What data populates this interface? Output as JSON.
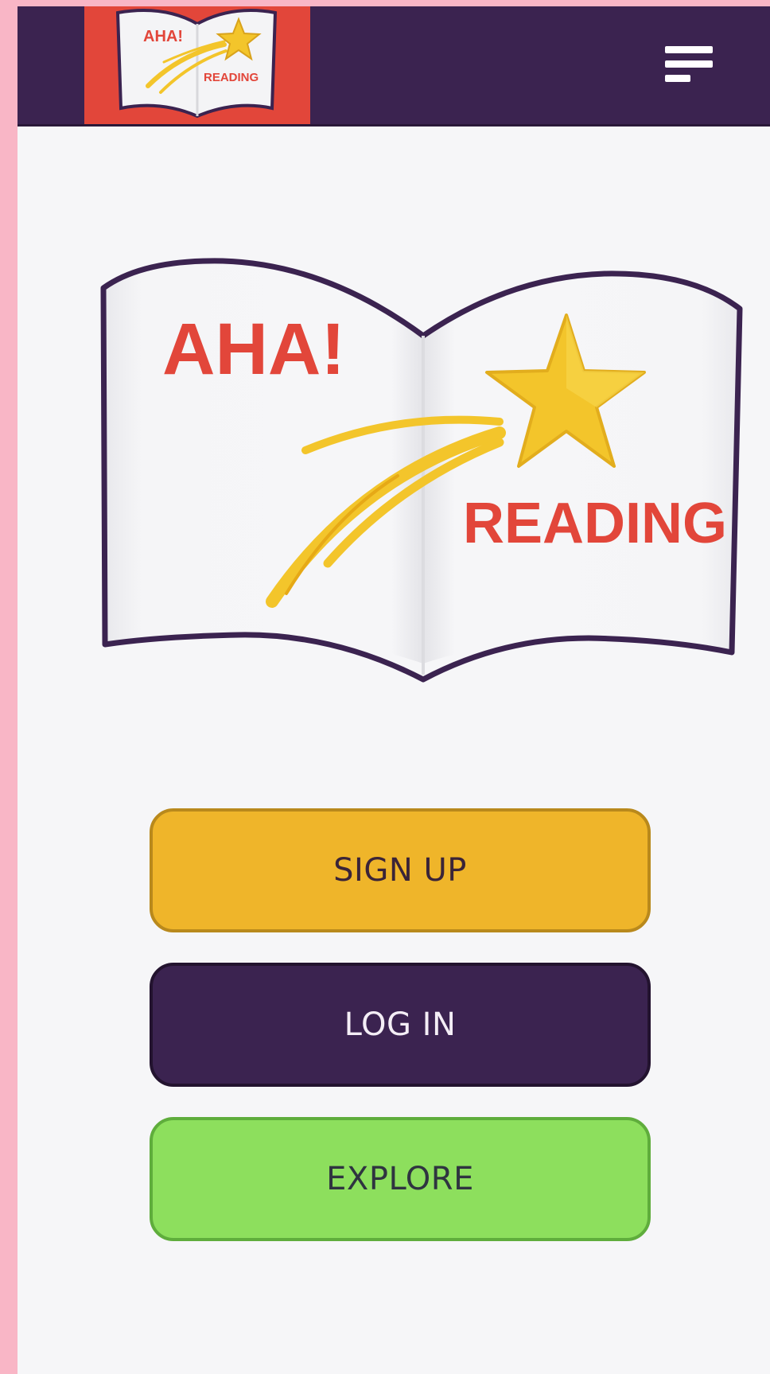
{
  "header": {
    "logo": {
      "line1": "AHA!",
      "line2": "READING"
    },
    "menu_icon": "hamburger-menu-icon"
  },
  "hero": {
    "line1": "AHA!",
    "line2": "READING",
    "icons": [
      "open-book-icon",
      "shooting-star-icon"
    ]
  },
  "actions": {
    "signup_label": "SIGN UP",
    "login_label": "LOG IN",
    "explore_label": "EXPLORE"
  },
  "colors": {
    "header_bg": "#3b2350",
    "logo_bg": "#e2463a",
    "signup": "#efb52a",
    "login": "#3b2350",
    "explore": "#8ddf5d",
    "brand_red": "#e2463a",
    "star_yellow": "#f3c52b"
  }
}
